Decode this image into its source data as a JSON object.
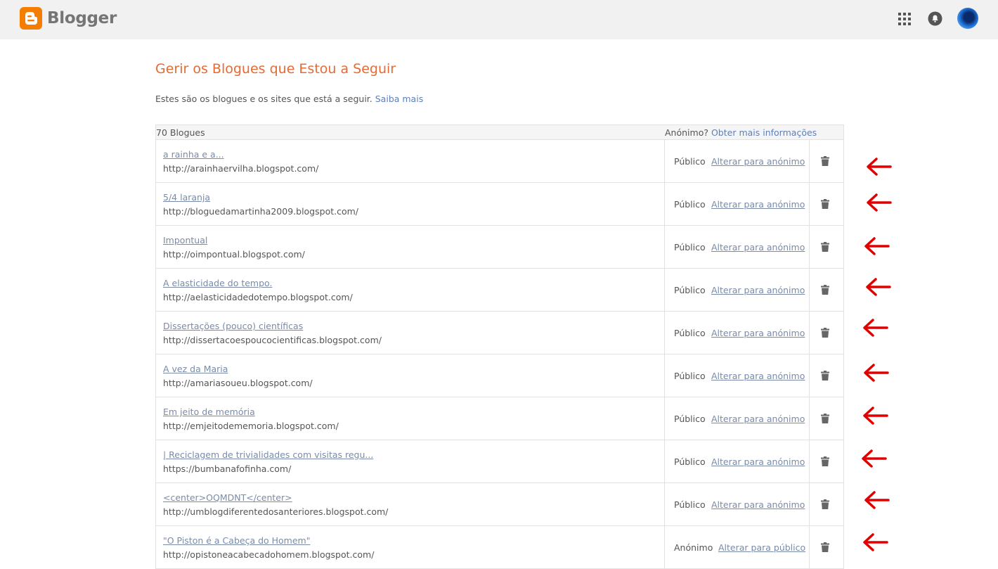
{
  "app": {
    "name": "Blogger"
  },
  "page": {
    "title": "Gerir os Blogues que Estou a Seguir",
    "intro_text": "Estes são os blogues e os sites que está a seguir.",
    "intro_link": "Saiba mais"
  },
  "table": {
    "count_label": "70 Blogues",
    "anon_question": "Anónimo?",
    "anon_link": "Obter mais informações"
  },
  "rows": [
    {
      "title": "a rainha e a...",
      "url": "http://arainhaervilha.blogspot.com/",
      "status": "Público",
      "change": "Alterar para anónimo"
    },
    {
      "title": "5/4 laranja",
      "url": "http://bloguedamartinha2009.blogspot.com/",
      "status": "Público",
      "change": "Alterar para anónimo"
    },
    {
      "title": "Impontual",
      "url": "http://oimpontual.blogspot.com/",
      "status": "Público",
      "change": "Alterar para anónimo"
    },
    {
      "title": "A elasticidade do tempo.",
      "url": "http://aelasticidadedotempo.blogspot.com/",
      "status": "Público",
      "change": "Alterar para anónimo"
    },
    {
      "title": "Dissertações (pouco) científicas",
      "url": "http://dissertacoespoucocientificas.blogspot.com/",
      "status": "Público",
      "change": "Alterar para anónimo"
    },
    {
      "title": "A vez da Maria",
      "url": "http://amariasoueu.blogspot.com/",
      "status": "Público",
      "change": "Alterar para anónimo"
    },
    {
      "title": "Em jeito de memória",
      "url": "http://emjeitodememoria.blogspot.com/",
      "status": "Público",
      "change": "Alterar para anónimo"
    },
    {
      "title": "| Reciclagem de trivialidades com visitas regu...",
      "url": "https://bumbanafofinha.com/",
      "status": "Público",
      "change": "Alterar para anónimo"
    },
    {
      "title": "<center>OQMDNT</center>",
      "url": "http://umblogdiferentedosanteriores.blogspot.com/",
      "status": "Público",
      "change": "Alterar para anónimo"
    },
    {
      "title": "\"O Piston é a Cabeça do Homem\"",
      "url": "http://opistoneacabecadohomem.blogspot.com/",
      "status": "Anónimo",
      "change": "Alterar para público"
    }
  ],
  "colors": {
    "title": "#e66a32",
    "link": "#5c7fb8",
    "arrow": "#e00000",
    "brand": "#f57d00"
  },
  "icons": {
    "logo": "blogger-logo-icon",
    "apps": "apps-grid-icon",
    "notifications": "bell-icon",
    "delete": "trash-icon",
    "annotation": "red-arrow-left-icon"
  }
}
